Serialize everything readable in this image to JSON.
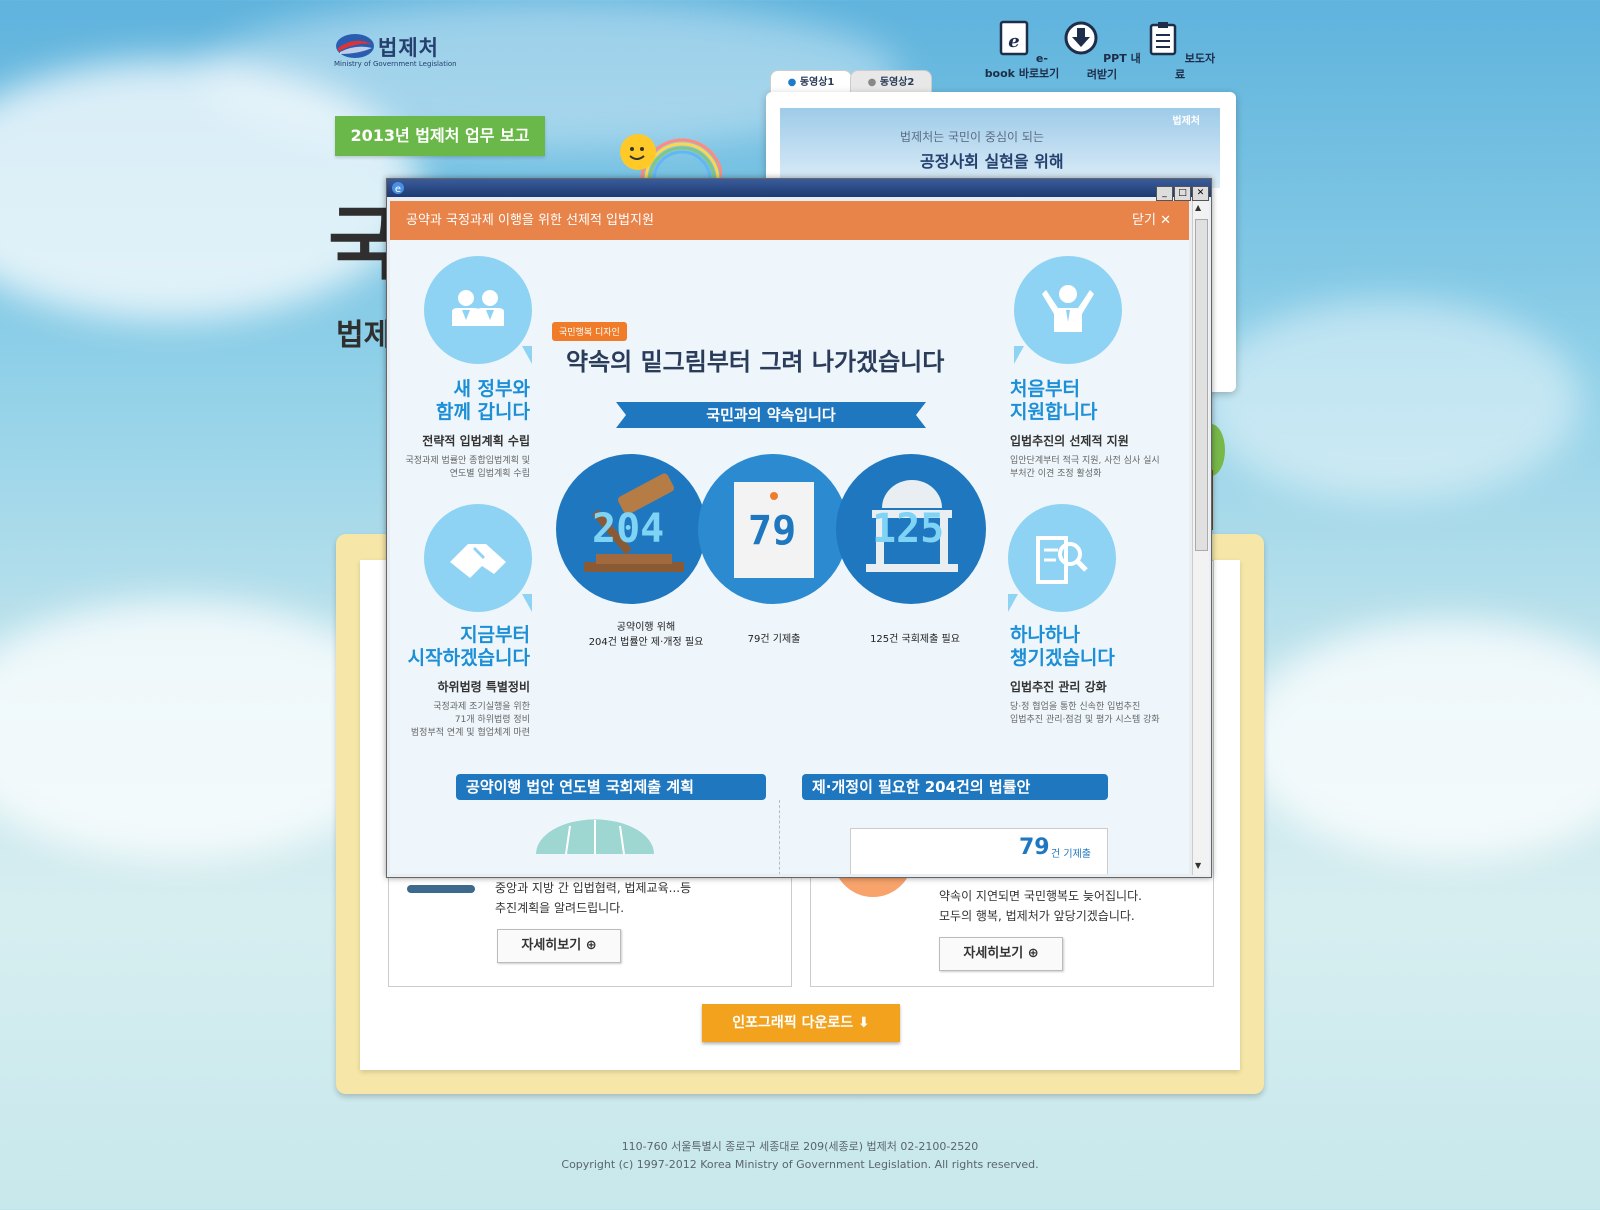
{
  "header": {
    "logo_name": "법제처",
    "logo_sub": "Ministry of Government Legislation",
    "tools": [
      {
        "label": "e-book 바로보기",
        "icon": "ebook-icon"
      },
      {
        "label": "PPT 내려받기",
        "icon": "download-icon"
      },
      {
        "label": "보도자료",
        "icon": "clipboard-icon"
      }
    ]
  },
  "hero": {
    "report_tag": "2013년 법제처 업무 보고",
    "big_char": "국",
    "small_char": "법제"
  },
  "video": {
    "tabs": [
      "동영상1",
      "동영상2"
    ],
    "logo": "법제처",
    "line1": "법제처는 국민이 중심이 되는",
    "line2": "공정사회 실현을 위해"
  },
  "popup": {
    "title": "공약과 국정과제 이행을 위한 선제적 입법지원",
    "close": "닫기 ✕",
    "badge": "국민행복 디자인",
    "headline": "약속의 밑그림부터 그려 나가겠습니다",
    "ribbon": "국민과의 약속입니다",
    "left_items": [
      {
        "title1": "새 정부와",
        "title2": "함께 갑니다",
        "sub": "전략적 입법계획 수립",
        "desc1": "국정과제 법률안 종합입법계획 및",
        "desc2": "연도별 입법계획 수립",
        "desc3": ""
      },
      {
        "title1": "지금부터",
        "title2": "시작하겠습니다",
        "sub": "하위법령 특별정비",
        "desc1": "국정과제 조기실행을 위한",
        "desc2": "71개 하위법령 정비",
        "desc3": "범정부적 연계 및 협업체계 마련"
      }
    ],
    "right_items": [
      {
        "title1": "처음부터",
        "title2": "지원합니다",
        "sub": "입법추진의 선제적 지원",
        "desc1": "입안단계부터 적극 지원, 사전 심사 실시",
        "desc2": "부처간 이견 조정 활성화"
      },
      {
        "title1": "하나하나",
        "title2": "챙기겠습니다",
        "sub": "입법추진 관리 강화",
        "desc1": "당·정 협업을 통한 신속한 입법추진",
        "desc2": "입법추진 관리·점검 및 평가 시스템 강화"
      }
    ],
    "circles": [
      {
        "num": "204",
        "cap1": "공약이행 위해",
        "cap2": "204건 법률안 제·개정 필요"
      },
      {
        "num": "79",
        "cap1": "",
        "cap2": "79건 기제출"
      },
      {
        "num": "125",
        "cap1": "",
        "cap2": "125건 국회제출 필요"
      }
    ],
    "section_left": "공약이행 법안 연도별 국회제출 계획",
    "section_right": "제·개정이 필요한 204건의 법률안",
    "mini_num": "79",
    "mini_label": "건 기제출"
  },
  "cards": {
    "left_line1": "중앙과 지방 간 입법협력, 법제교육...등",
    "left_line2": "추진계획을 알려드립니다.",
    "right_line1": "약속이 지연되면 국민행복도 늦어집니다.",
    "right_line2": "모두의 행복, 법제처가 앞당기겠습니다.",
    "detail": "자세히보기 ⊕"
  },
  "download": "인포그래픽 다운로드 ⬇",
  "footer": {
    "line1": "110-760 서울특별시 종로구 세종대로 209(세종로) 법제처 02-2100-2520",
    "line2": "Copyright (c) 1997-2012 Korea Ministry of Government Legislation. All rights reserved."
  }
}
